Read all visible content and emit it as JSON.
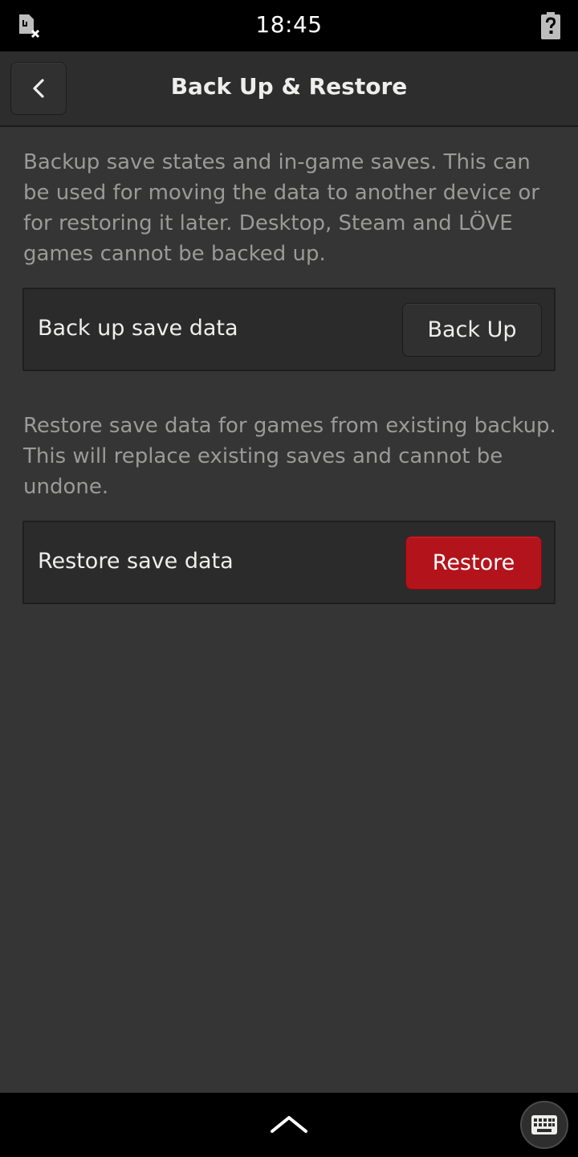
{
  "status_bar": {
    "time": "18:45",
    "icons": [
      "sim-missing-icon",
      "battery-unknown-icon"
    ]
  },
  "header": {
    "title": "Back Up & Restore",
    "back_icon": "chevron-left-icon"
  },
  "backup_section": {
    "description": "Backup save states and in-game saves. This can be used for moving the data to another device or for restoring it later. Desktop, Steam and LÖVE games cannot be backed up.",
    "row_label": "Back up save data",
    "button_label": "Back Up"
  },
  "restore_section": {
    "description": "Restore save data for games from existing backup. This will replace existing saves and cannot be undone.",
    "row_label": "Restore save data",
    "button_label": "Restore",
    "button_color": "#b3141b"
  },
  "bottom_bar": {
    "icons": [
      "chevron-up-icon",
      "keyboard-icon"
    ]
  },
  "colors": {
    "background": "#353535",
    "header": "#2d2d2d",
    "row": "#2b2b2b",
    "destructive": "#b3141b"
  }
}
